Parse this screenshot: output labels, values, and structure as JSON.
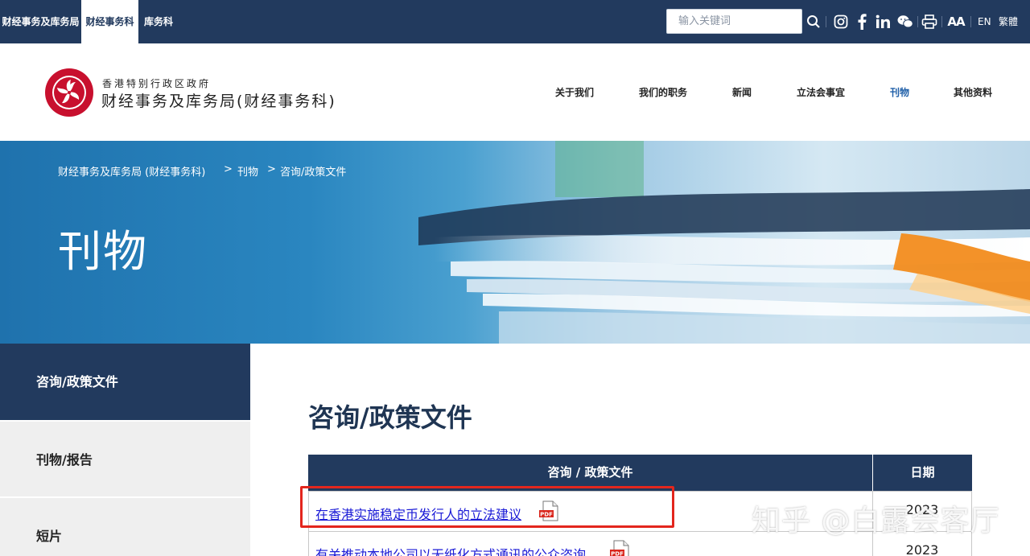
{
  "topbar": {
    "tabs": [
      "财经事务及库务局",
      "财经事务科",
      "库务科"
    ],
    "search_placeholder": "输入关键词",
    "lang_en": "EN",
    "lang_tc": "繁體",
    "font_size_label": "AA"
  },
  "header": {
    "org_sub": "香港特别行政区政府",
    "org_main": "财经事务及库务局(财经事务科)",
    "nav": [
      "关于我们",
      "我们的职务",
      "新闻",
      "立法会事宜",
      "刊物",
      "其他资料"
    ]
  },
  "banner": {
    "breadcrumb": [
      "财经事务及库务局 (财经事务科)",
      "刊物",
      "咨询/政策文件"
    ],
    "separator": ">",
    "title": "刊物"
  },
  "sidebar": {
    "items": [
      "咨询/政策文件",
      "刊物/报告",
      "短片"
    ]
  },
  "content": {
    "title": "咨询/政策文件",
    "table": {
      "headers": [
        "咨询 / 政策文件",
        "日期"
      ],
      "rows": [
        {
          "title": "在香港实施稳定币发行人的立法建议",
          "date": "2023"
        },
        {
          "title": "有关推动本地公司以无纸化方式通讯的公众咨询",
          "date": "2023"
        }
      ],
      "pdf_label": "PDF"
    }
  },
  "watermark": "知乎 @白露会客厅",
  "colors": {
    "navy": "#223a5e",
    "link": "#1a1ad6",
    "highlight": "#e3261d",
    "active_nav": "#1f5fa8"
  }
}
